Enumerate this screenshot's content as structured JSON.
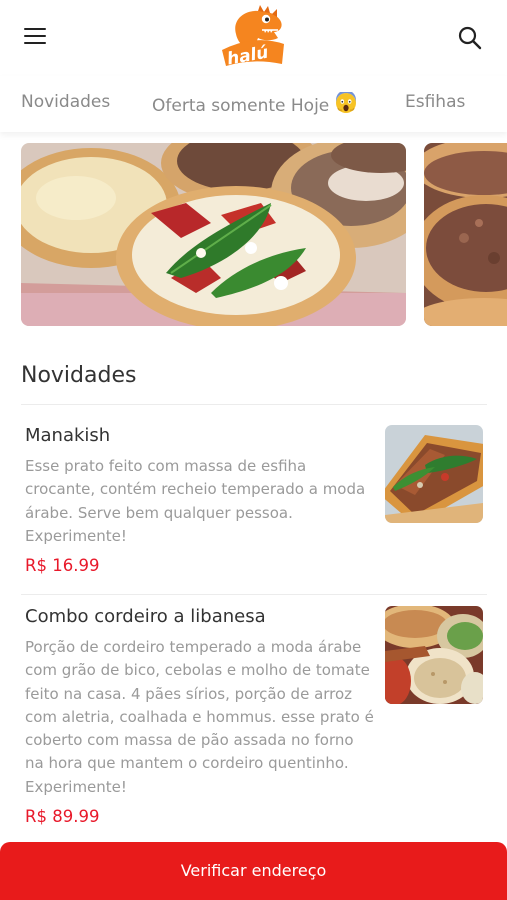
{
  "header": {
    "logo_text": "halú",
    "menu_icon": "hamburger-menu-icon",
    "search_icon": "search-icon"
  },
  "tabs": [
    {
      "label": "Novidades"
    },
    {
      "label": "Oferta somente Hoje",
      "emoji": "😱"
    },
    {
      "label": "Esfihas"
    }
  ],
  "banners": [
    {
      "image": "esfihas-pizza-photo"
    },
    {
      "image": "meat-esfiha-photo"
    }
  ],
  "section": {
    "title": "Novidades"
  },
  "items": [
    {
      "name": "Manakish",
      "description_lines": [
        "Esse prato feito com massa de esfiha",
        "crocante, contém recheio temperado a moda",
        "árabe. Serve bem qualquer pessoa.",
        "Experimente!"
      ],
      "price": "R$ 16.99",
      "image": "manakish-photo"
    },
    {
      "name": "Combo cordeiro a libanesa",
      "description_lines": [
        "Porção de cordeiro temperado a moda árabe",
        "com grão de bico, cebolas e molho de tomate",
        "feito na casa. 4 pães sírios, porção de arroz",
        "com aletria, coalhada e hommus. esse prato é",
        "coberto com massa de pão assada no forno",
        "na hora que mantem o cordeiro quentinho.",
        "Experimente!"
      ],
      "price": "R$ 89.99",
      "image": "lamb-combo-photo"
    }
  ],
  "footer": {
    "button_label": "Verificar endereço"
  },
  "colors": {
    "accent": "#e81b1b",
    "price": "#e8192a",
    "muted_text": "#9a9a9a",
    "logo_orange": "#f5851f"
  }
}
